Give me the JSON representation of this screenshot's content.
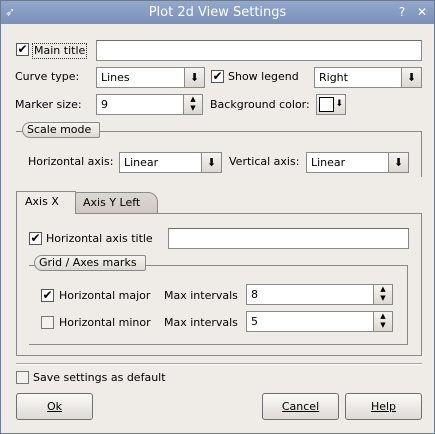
{
  "window": {
    "title": "Plot 2d View Settings",
    "icon": "app-icon",
    "help_glyph": "?",
    "close_glyph": "✕"
  },
  "general": {
    "main_title_label": "Main title",
    "main_title_checked": true,
    "main_title_value": "",
    "curve_type_label": "Curve type:",
    "curve_type_value": "Lines",
    "show_legend_label": "Show legend",
    "show_legend_checked": true,
    "legend_position_value": "Right",
    "marker_size_label": "Marker size:",
    "marker_size_value": "9",
    "background_color_label": "Background color:",
    "background_color": "#ffffff"
  },
  "scale_mode": {
    "title": "Scale mode",
    "horizontal_axis_label": "Horizontal axis:",
    "horizontal_axis_value": "Linear",
    "vertical_axis_label": "Vertical axis:",
    "vertical_axis_value": "Linear"
  },
  "tabs": [
    {
      "label": "Axis X",
      "active": true
    },
    {
      "label": "Axis Y Left",
      "active": false
    }
  ],
  "axis_x": {
    "axis_title_label": "Horizontal axis title",
    "axis_title_checked": true,
    "axis_title_value": "",
    "grid_group_title": "Grid / Axes marks",
    "major_label": "Horizontal major",
    "major_checked": true,
    "major_max_intervals_label": "Max intervals",
    "major_max_intervals_value": "8",
    "minor_label": "Horizontal minor",
    "minor_checked": false,
    "minor_max_intervals_label": "Max intervals",
    "minor_max_intervals_value": "5"
  },
  "footer": {
    "save_default_label": "Save settings as default",
    "save_default_checked": false,
    "ok_label": "Ok",
    "cancel_label": "Cancel",
    "help_label": "Help"
  },
  "colors": {
    "titlebar": "#7a91b9",
    "dialog_bg": "#efebe7"
  }
}
